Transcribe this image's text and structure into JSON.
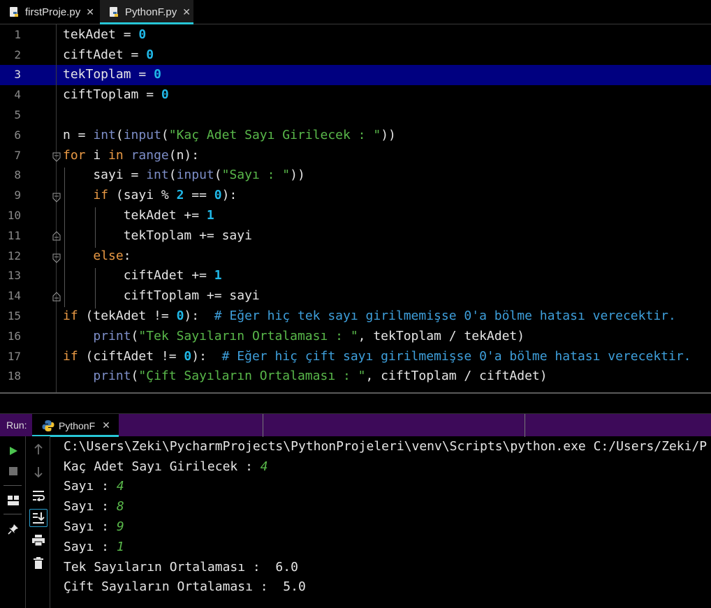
{
  "tabs": [
    {
      "label": "firstProje.py",
      "active": false
    },
    {
      "label": "PythonF.py",
      "active": true
    }
  ],
  "editor": {
    "current_line": 3,
    "line_numbers": [
      "1",
      "2",
      "3",
      "4",
      "5",
      "6",
      "7",
      "8",
      "9",
      "10",
      "11",
      "12",
      "13",
      "14",
      "15",
      "16",
      "17",
      "18"
    ],
    "code": {
      "l1_var": "tekAdet",
      "l1_op": " = ",
      "l1_num": "0",
      "l2_var": "ciftAdet",
      "l2_op": " = ",
      "l2_num": "0",
      "l3_var": "tekToplam",
      "l3_op": " = ",
      "l3_num": "0",
      "l4_var": "ciftToplam",
      "l4_op": " = ",
      "l4_num": "0",
      "l6_a": "n = ",
      "l6_int": "int",
      "l6_p1": "(",
      "l6_input": "input",
      "l6_p2": "(",
      "l6_str": "\"Kaç Adet Sayı Girilecek : \"",
      "l6_p3": "))",
      "l7_for": "for",
      "l7_a": " i ",
      "l7_in": "in",
      "l7_sp": " ",
      "l7_range": "range",
      "l7_b": "(n):",
      "l8_a": "    sayi = ",
      "l8_int": "int",
      "l8_p1": "(",
      "l8_input": "input",
      "l8_p2": "(",
      "l8_str": "\"Sayı : \"",
      "l8_p3": "))",
      "l9_sp": "    ",
      "l9_if": "if",
      "l9_a": " (sayi % ",
      "l9_n1": "2",
      "l9_b": " == ",
      "l9_n2": "0",
      "l9_c": "):",
      "l10_a": "        tekAdet += ",
      "l10_n": "1",
      "l11_a": "        tekToplam += sayi",
      "l12_sp": "    ",
      "l12_else": "else",
      "l12_c": ":",
      "l13_a": "        ciftAdet += ",
      "l13_n": "1",
      "l14_a": "        ciftToplam += sayi",
      "l15_if": "if",
      "l15_a": " (tekAdet != ",
      "l15_n": "0",
      "l15_b": "):  ",
      "l15_cmt": "# Eğer hiç tek sayı girilmemişse 0'a bölme hatası verecektir.",
      "l16_sp": "    ",
      "l16_print": "print",
      "l16_p1": "(",
      "l16_str": "\"Tek Sayıların Ortalaması : \"",
      "l16_b": ", tekToplam / tekAdet)",
      "l17_if": "if",
      "l17_a": " (ciftAdet != ",
      "l17_n": "0",
      "l17_b": "):  ",
      "l17_cmt": "# Eğer hiç çift sayı girilmemişse 0'a bölme hatası verecektir.",
      "l18_sp": "    ",
      "l18_print": "print",
      "l18_p1": "(",
      "l18_str": "\"Çift Sayıların Ortalaması : \"",
      "l18_b": ", ciftToplam / ciftAdet)"
    }
  },
  "run_panel": {
    "label": "Run:",
    "tab_label": "PythonF",
    "console": {
      "command": "C:\\Users\\Zeki\\PycharmProjects\\PythonProjeleri\\venv\\Scripts\\python.exe C:/Users/Zeki/P",
      "prompt1": "Kaç Adet Sayı Girilecek : ",
      "input1": "4",
      "prompt2": "Sayı : ",
      "input2": "4",
      "prompt3": "Sayı : ",
      "input3": "8",
      "prompt4": "Sayı : ",
      "input4": "9",
      "prompt5": "Sayı : ",
      "input5": "1",
      "out1": "Tek Sayıların Ortalaması :  6.0",
      "out2": "Çift Sayıların Ortalaması :  5.0"
    }
  },
  "colors": {
    "keyword": "#ea9a45",
    "builtin": "#7d8ec8",
    "number": "#20b8e8",
    "string": "#59b84a",
    "comment": "#3e9fdb",
    "current_line": "#000080",
    "run_bar": "#3d0a59",
    "tab_underline": "#27c6d6"
  },
  "icons": [
    "python-file-icon",
    "close-icon",
    "fold-icon",
    "run-icon",
    "stop-icon",
    "layout-icon",
    "pin-icon",
    "up-arrow-icon",
    "down-arrow-icon",
    "soft-wrap-icon",
    "scroll-to-end-icon",
    "print-icon",
    "trash-icon"
  ]
}
